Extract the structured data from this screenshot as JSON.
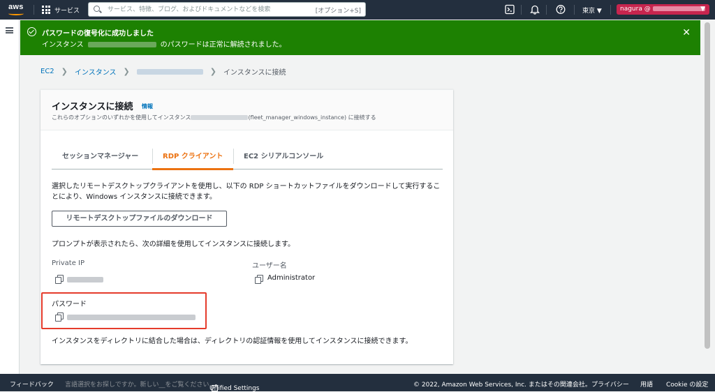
{
  "topbar": {
    "logo_text": "aws",
    "services_label": "サービス",
    "search_placeholder": "サービス、特徴、ブログ、およびドキュメントなどを検索",
    "search_shortcut": "[オプション+S]",
    "region": "東京 ▼",
    "account_user": "nagura @",
    "account_caret": "▼"
  },
  "flash": {
    "heading": "パスワードの復号化に成功しました",
    "message_prefix": "インスタンス",
    "message_suffix": "のパスワードは正常に解読されました。",
    "close": "✕"
  },
  "breadcrumb": {
    "items": [
      "EC2",
      "インスタンス"
    ],
    "current": "インスタンスに接続",
    "separator": "❯"
  },
  "card": {
    "title": "インスタンスに接続",
    "info": "情報",
    "subtitle_prefix": "これらのオプションのいずれかを使用してインスタンス",
    "subtitle_suffix": "(fleet_manager_windows_instance) に接続する"
  },
  "tabs": [
    {
      "label": "セッションマネージャー",
      "active": false
    },
    {
      "label": "RDP クライアント",
      "active": true
    },
    {
      "label": "EC2 シリアルコンソール",
      "active": false
    }
  ],
  "rdp": {
    "description": "選択したリモートデスクトップクライアントを使用し、以下の RDP ショートカットファイルをダウンロードして実行することにより、Windows インスタンスに接続できます。",
    "download_button": "リモートデスクトップファイルのダウンロード",
    "prompt": "プロンプトが表示されたら、次の詳細を使用してインスタンスに接続します。",
    "private_ip_label": "Private IP",
    "username_label": "ユーザー名",
    "username_value": "Administrator",
    "password_label": "パスワード",
    "directory_note": "インスタンスをディレクトリに結合した場合は、ディレクトリの認証情報を使用してインスタンスに接続できます。"
  },
  "footer": {
    "feedback": "フィードバック",
    "language_prompt": "言語選択をお探しですか。新しい__をご覧ください",
    "unified_settings": "Unified Settings",
    "copyright": "© 2022, Amazon Web Services, Inc. またはその関連会社。",
    "privacy": "プライバシー",
    "terms": "用語",
    "cookie": "Cookie の設定"
  },
  "colors": {
    "topbar": "#232f3e",
    "success": "#1d8102",
    "accent": "#ec7211",
    "link": "#0073bb",
    "highlight": "#e53b2b",
    "account": "#c7254e"
  },
  "icons": [
    "aws-logo-icon",
    "apps-grid-icon",
    "search-icon",
    "cloudshell-icon",
    "bell-icon",
    "help-icon",
    "menu-icon",
    "check-circle-icon",
    "close-icon",
    "copy-icon",
    "external-link-icon"
  ]
}
